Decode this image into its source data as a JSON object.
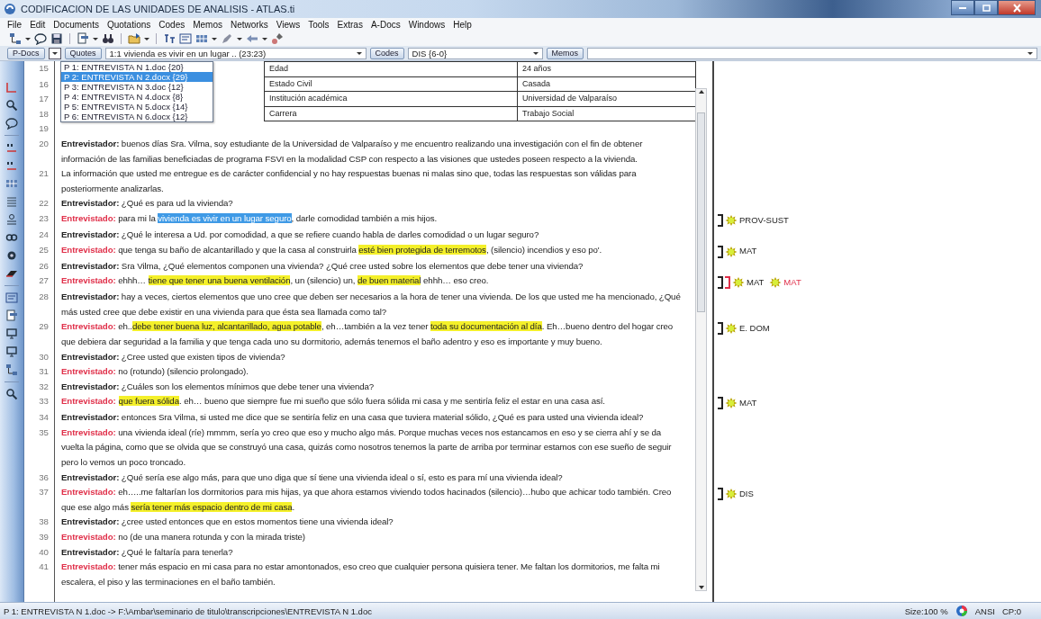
{
  "window": {
    "title": "CODIFICACION DE LAS UNIDADES DE ANALISIS - ATLAS.ti"
  },
  "menu": [
    "File",
    "Edit",
    "Documents",
    "Quotations",
    "Codes",
    "Memos",
    "Networks",
    "Views",
    "Tools",
    "Extras",
    "A-Docs",
    "Windows",
    "Help"
  ],
  "selector_bar": {
    "pdocs_button": "P-Docs",
    "quotes_button": "Quotes",
    "quote_value": "1:1 vivienda es vivir en un lugar .. (23:23)",
    "codes_button": "Codes",
    "code_value": "DIS {6-0}",
    "memos_button": "Memos"
  },
  "pdocs_list": [
    {
      "label": "P 1: ENTREVISTA N 1.doc {20}",
      "selected": false
    },
    {
      "label": "P 2: ENTREVISTA N 2.docx {29}",
      "selected": true
    },
    {
      "label": "P 3: ENTREVISTA N 3.doc {12}",
      "selected": false
    },
    {
      "label": "P 4: ENTREVISTA N 4.docx {8}",
      "selected": false
    },
    {
      "label": "P 5: ENTREVISTA N 5.docx {14}",
      "selected": false
    },
    {
      "label": "P 6: ENTREVISTA N 6.docx {12}",
      "selected": false
    }
  ],
  "document": {
    "header_table": [
      {
        "number": "15",
        "label": "Edad",
        "value": "24 años"
      },
      {
        "number": "16",
        "label": "Estado Civil",
        "value": "Casada"
      },
      {
        "number": "17",
        "label": "Institución académica",
        "value": "Universidad de Valparaíso"
      },
      {
        "number": "18",
        "label": "Carrera",
        "value": "Trabajo Social"
      }
    ],
    "paragraphs": [
      {
        "number": "19",
        "kind": "blank"
      },
      {
        "number": "20",
        "kind": "interviewer",
        "speaker": "Entrevistador:",
        "segments": [
          {
            "text": " buenos días Sra. Vilma, soy estudiante de la Universidad de Valparaíso y me encuentro realizando una investigación con el fin de obtener información de las familias beneficiadas de programa FSVI en la modalidad CSP con respecto a las visiones que ustedes poseen respecto a la vivienda.",
            "kind": "plain"
          }
        ]
      },
      {
        "number": "21",
        "kind": "plain",
        "segments": [
          {
            "text": "La información que usted me entregue es de carácter confidencial y no hay respuestas buenas ni malas sino que, todas las respuestas son válidas para posteriormente analizarlas.",
            "kind": "plain"
          }
        ]
      },
      {
        "number": "22",
        "kind": "interviewer",
        "speaker": "Entrevistador:",
        "segments": [
          {
            "text": " ¿Qué es para ud la vivienda?",
            "kind": "plain"
          }
        ]
      },
      {
        "number": "23",
        "kind": "interviewee",
        "speaker": "Entrevistado:",
        "segments": [
          {
            "text": " para mi la ",
            "kind": "plain"
          },
          {
            "text": "vivienda es vivir en un lugar seguro",
            "kind": "selection"
          },
          {
            "text": ", darle comodidad también a mis hijos.",
            "kind": "plain"
          }
        ],
        "codes": [
          {
            "label": "PROV-SUST",
            "color": "#222222"
          }
        ]
      },
      {
        "number": "24",
        "kind": "interviewer",
        "speaker": "Entrevistador:",
        "segments": [
          {
            "text": " ¿Qué le interesa a Ud. por comodidad, a que se refiere cuando habla de darles comodidad o un lugar seguro?",
            "kind": "plain"
          }
        ]
      },
      {
        "number": "25",
        "kind": "interviewee",
        "speaker": "Entrevistado:",
        "segments": [
          {
            "text": " que tenga su baño de alcantarillado y que la casa al construirla ",
            "kind": "plain"
          },
          {
            "text": "esté bien protegida de terremotos",
            "kind": "highlight"
          },
          {
            "text": ", (silencio) incendios y eso po'.",
            "kind": "plain"
          }
        ],
        "codes": [
          {
            "label": "MAT",
            "color": "#222222"
          }
        ]
      },
      {
        "number": "26",
        "kind": "interviewer",
        "speaker": "Entrevistador:",
        "segments": [
          {
            "text": " Sra Vilma, ¿Qué elementos componen una vivienda? ¿Qué cree usted sobre los elementos que debe tener una vivienda?",
            "kind": "plain"
          }
        ]
      },
      {
        "number": "27",
        "kind": "interviewee",
        "speaker": "Entrevistado:",
        "segments": [
          {
            "text": " ehhh… ",
            "kind": "plain"
          },
          {
            "text": "tiene que tener una buena ventilación",
            "kind": "highlight"
          },
          {
            "text": ", un (silencio) un, ",
            "kind": "plain"
          },
          {
            "text": "de buen material",
            "kind": "highlight"
          },
          {
            "text": " ehhh… eso creo.",
            "kind": "plain"
          }
        ],
        "codes": [
          {
            "label": "MAT",
            "color": "#222222"
          },
          {
            "label": "MAT",
            "color": "#e0304a"
          }
        ]
      },
      {
        "number": "28",
        "kind": "interviewer",
        "speaker": "Entrevistador:",
        "segments": [
          {
            "text": " hay a veces, ciertos elementos que uno cree que deben ser necesarios a la hora de tener una vivienda. De los que usted me ha mencionado, ¿Qué más usted cree que debe existir en una vivienda para que ésta sea llamada como tal?",
            "kind": "plain"
          }
        ]
      },
      {
        "number": "29",
        "kind": "interviewee",
        "speaker": "Entrevistado:",
        "segments": [
          {
            "text": " eh..",
            "kind": "plain"
          },
          {
            "text": "debe tener buena luz, alcantarillado, agua potable",
            "kind": "highlight"
          },
          {
            "text": ", eh…también a la vez tener ",
            "kind": "plain"
          },
          {
            "text": "toda su documentación al día",
            "kind": "highlight"
          },
          {
            "text": ". Eh…bueno dentro del hogar creo que debiera dar seguridad a la familia y que tenga cada uno su dormitorio, además tenemos el baño adentro y eso es importante y muy bueno.",
            "kind": "plain"
          }
        ],
        "codes": [
          {
            "label": "E. DOM",
            "color": "#222222"
          }
        ]
      },
      {
        "number": "30",
        "kind": "interviewer",
        "speaker": "Entrevistador:",
        "segments": [
          {
            "text": " ¿Cree usted que existen tipos de vivienda?",
            "kind": "plain"
          }
        ]
      },
      {
        "number": "31",
        "kind": "interviewee",
        "speaker": "Entrevistado:",
        "segments": [
          {
            "text": " no (rotundo) (silencio prolongado).",
            "kind": "plain"
          }
        ]
      },
      {
        "number": "32",
        "kind": "interviewer",
        "speaker": "Entrevistador:",
        "segments": [
          {
            "text": " ¿Cuáles son los elementos mínimos que debe tener una vivienda?",
            "kind": "plain"
          }
        ]
      },
      {
        "number": "33",
        "kind": "interviewee",
        "speaker": "Entrevistado:",
        "segments": [
          {
            "text": "que fuera sólida",
            "kind": "highlight"
          },
          {
            "text": ". eh… bueno que siempre fue mi sueño que sólo fuera sólida mi casa y me sentiría feliz el estar en una casa así.",
            "kind": "plain"
          }
        ],
        "codes": [
          {
            "label": "MAT",
            "color": "#222222"
          }
        ]
      },
      {
        "number": "34",
        "kind": "interviewer",
        "speaker": "Entrevistador:",
        "segments": [
          {
            "text": " entonces Sra Vilma, si usted me dice que se sentiría feliz en una casa que tuviera material sólido, ¿Qué es para usted una vivienda ideal?",
            "kind": "plain"
          }
        ]
      },
      {
        "number": "35",
        "kind": "interviewee",
        "speaker": "Entrevistado:",
        "segments": [
          {
            "text": " una vivienda ideal (ríe) mmmm, sería yo creo que eso y mucho algo más. Porque muchas veces nos estancamos en eso y se cierra ahí y se da vuelta la página, como que se olvida que se construyó una casa, quizás como nosotros tenemos la parte de arriba por terminar estamos con ese sueño de seguir pero lo vemos un poco troncado.",
            "kind": "plain"
          }
        ]
      },
      {
        "number": "36",
        "kind": "interviewer",
        "speaker": "Entrevistador:",
        "segments": [
          {
            "text": " ¿Qué sería ese algo más, para que uno diga que sí tiene una vivienda ideal o sí, esto es para mí una vivienda ideal?",
            "kind": "plain"
          }
        ]
      },
      {
        "number": "37",
        "kind": "interviewee",
        "speaker": "Entrevistado:",
        "segments": [
          {
            "text": " eh…..me faltarían los dormitorios para mis hijas, ya que ahora estamos viviendo todos hacinados (silencio)…hubo que achicar todo también. Creo que ese algo más ",
            "kind": "plain"
          },
          {
            "text": "sería tener más espacio dentro de mi casa",
            "kind": "highlight"
          },
          {
            "text": ".",
            "kind": "plain"
          }
        ],
        "codes": [
          {
            "label": "DIS",
            "color": "#222222"
          }
        ]
      },
      {
        "number": "38",
        "kind": "interviewer",
        "speaker": "Entrevistador:",
        "segments": [
          {
            "text": " ¿cree usted entonces que en estos momentos tiene una vivienda ideal?",
            "kind": "plain"
          }
        ]
      },
      {
        "number": "39",
        "kind": "interviewee",
        "speaker": "Entrevistado:",
        "segments": [
          {
            "text": " no (de una manera rotunda y con la mirada triste)",
            "kind": "plain"
          }
        ]
      },
      {
        "number": "40",
        "kind": "interviewer",
        "speaker": "Entrevistador:",
        "segments": [
          {
            "text": " ¿Qué le faltaría para tenerla?",
            "kind": "plain"
          }
        ]
      },
      {
        "number": "41",
        "kind": "interviewee",
        "speaker": "Entrevistado:",
        "segments": [
          {
            "text": " tener más espacio en mi casa para no estar amontonados, eso creo que cualquier persona quisiera tener. Me faltan los dormitorios, me falta mi escalera, el piso y las terminaciones en el baño también.",
            "kind": "plain"
          }
        ]
      }
    ]
  },
  "status_bar": {
    "path": "P 1: ENTREVISTA N 1.doc -> F:\\Ambar\\seminario de titulo\\transcripciones\\ENTREVISTA N 1.doc",
    "size": "Size:100 %",
    "encoding": "ANSI",
    "cp": "CP:0"
  }
}
